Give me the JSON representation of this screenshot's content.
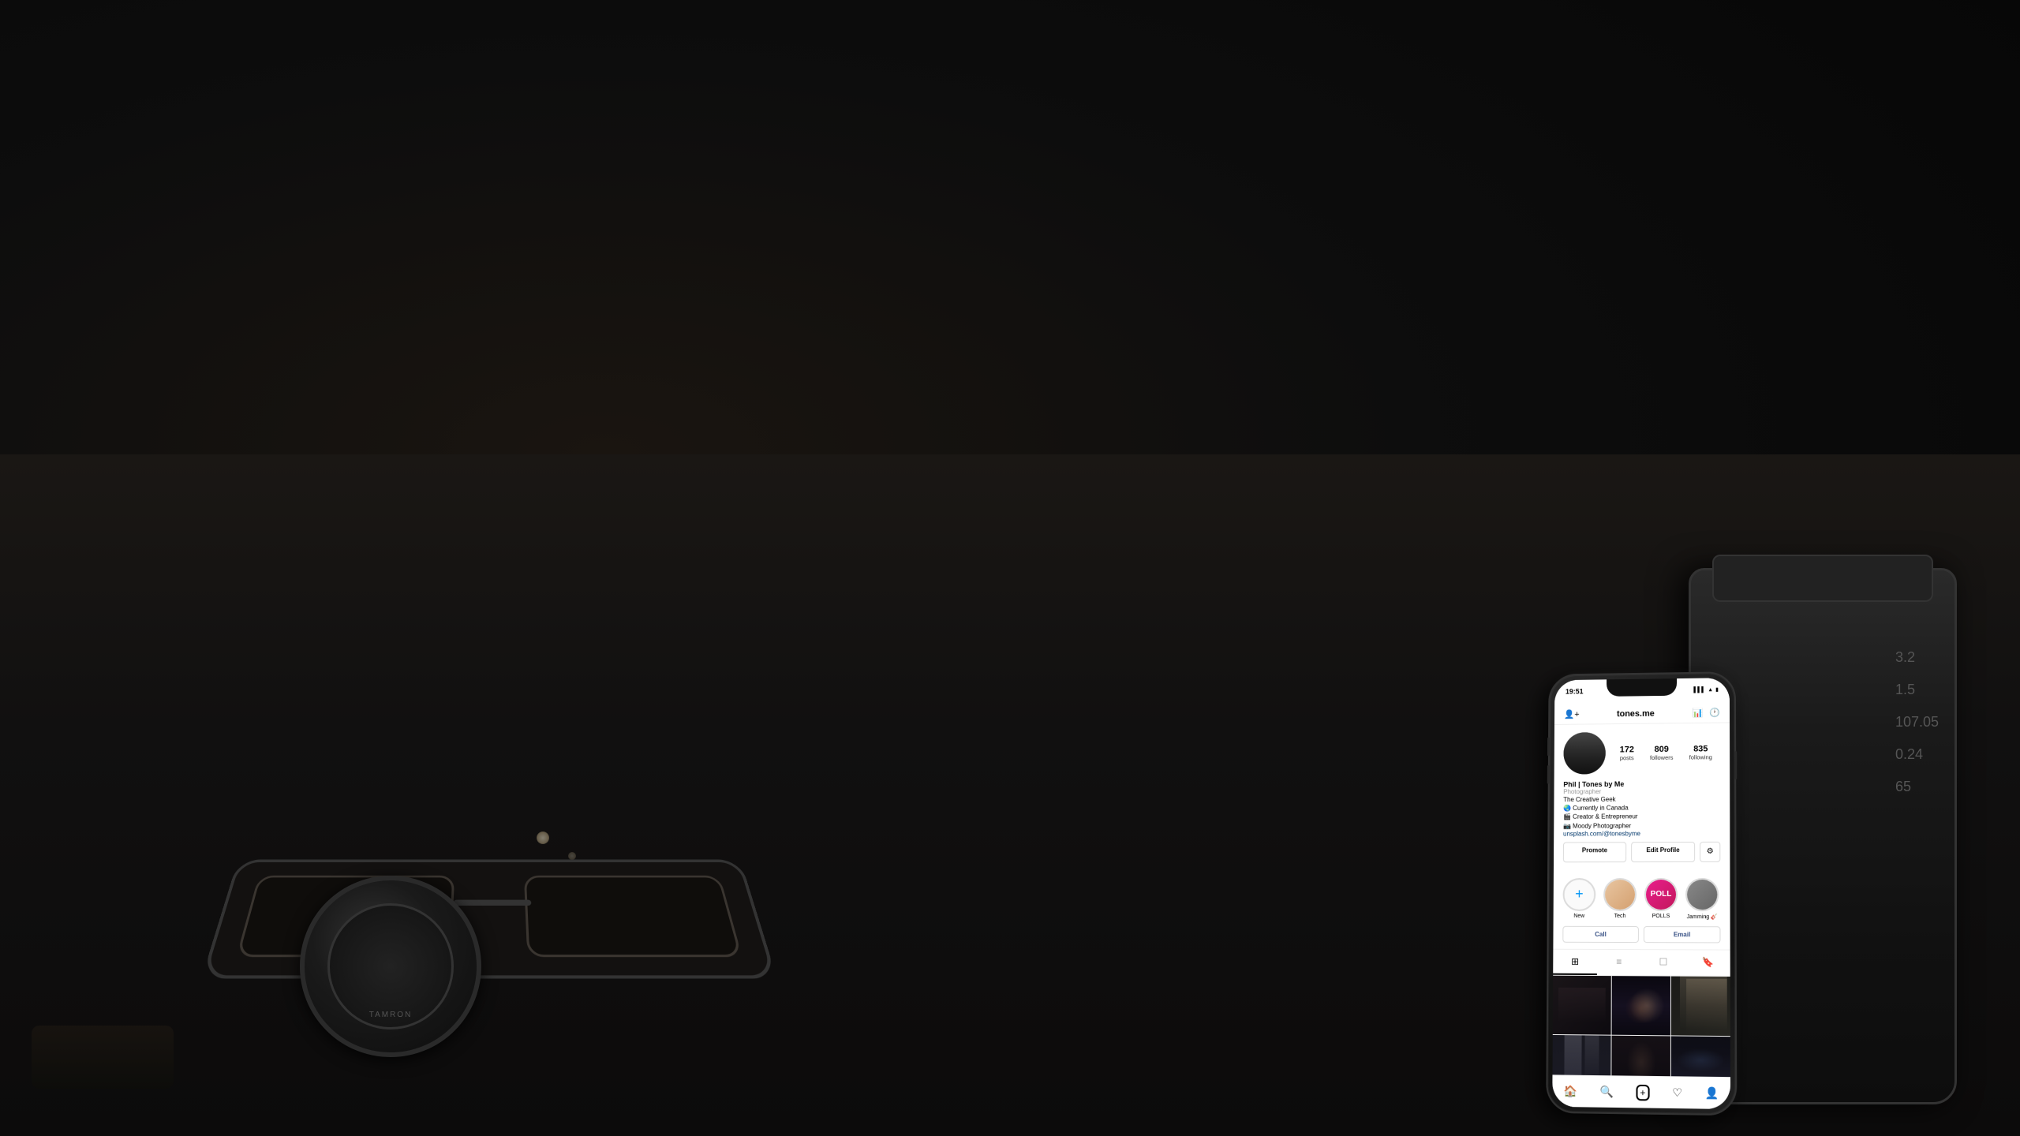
{
  "scene": {
    "background_color": "#0a0a0a"
  },
  "phone": {
    "status_bar": {
      "time": "19:51",
      "signal_icon": "▌▌▌",
      "wifi_icon": "wifi",
      "battery_icon": "▮"
    },
    "instagram": {
      "topnav": {
        "left_icon": "person-add-icon",
        "username": "tones.me",
        "right_icons": [
          "chart-icon",
          "clock-icon"
        ]
      },
      "profile": {
        "stats": [
          {
            "num": "172",
            "label": "posts"
          },
          {
            "num": "809",
            "label": "followers"
          },
          {
            "num": "835",
            "label": "following"
          }
        ],
        "buttons": {
          "promote": "Promote",
          "edit_profile": "Edit Profile",
          "settings_icon": "⚙"
        },
        "bio": {
          "name": "Phil | Tones by Me",
          "tag": "Photographer",
          "line1": "The Creative Geek",
          "line2": "🌏 Currently in Canada",
          "line3": "🎬 Creator & Entrepreneur",
          "line4": "📷 Moody Photographer",
          "link": "unsplash.com/@tonesbyme"
        }
      },
      "stories": [
        {
          "label": "New",
          "type": "new"
        },
        {
          "label": "Tech",
          "type": "tech"
        },
        {
          "label": "POLLS",
          "type": "polls"
        },
        {
          "label": "Jamming 🎸",
          "type": "jamming"
        }
      ],
      "contact_row": {
        "call": "Call",
        "email": "Email"
      },
      "grid_tabs": [
        {
          "icon": "⊞",
          "active": true
        },
        {
          "icon": "≡",
          "active": false
        },
        {
          "icon": "☐",
          "active": false
        },
        {
          "icon": "⊙",
          "active": false
        }
      ],
      "photos": [
        {
          "id": 1,
          "desc": "dark music photo"
        },
        {
          "id": 2,
          "desc": "guitarist"
        },
        {
          "id": 3,
          "desc": "person outdoors"
        },
        {
          "id": 4,
          "desc": "building architecture"
        },
        {
          "id": 5,
          "desc": "person portrait"
        },
        {
          "id": 6,
          "desc": "night scene"
        }
      ],
      "bottom_nav": [
        {
          "icon": "🏠",
          "active": true
        },
        {
          "icon": "🔍",
          "active": false
        },
        {
          "icon": "➕",
          "active": false
        },
        {
          "icon": "♡",
          "active": false
        },
        {
          "icon": "👤",
          "active": false
        }
      ]
    }
  }
}
